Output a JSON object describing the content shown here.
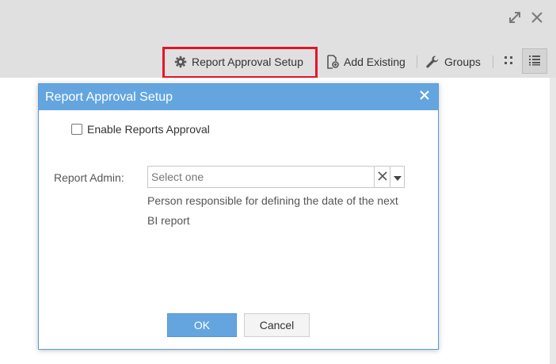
{
  "toolbar": {
    "report_approval_label": "Report Approval Setup",
    "add_existing_label": "Add Existing",
    "groups_label": "Groups"
  },
  "dialog": {
    "title": "Report Approval Setup",
    "enable_label": "Enable Reports Approval",
    "report_admin_label": "Report Admin:",
    "report_admin_placeholder": "Select one",
    "report_admin_help": "Person responsible for defining the date of the next BI report",
    "ok_label": "OK",
    "cancel_label": "Cancel"
  },
  "colors": {
    "accent": "#64a5e0",
    "highlight": "#e0162b"
  },
  "icons": {
    "expand": "expand-icon",
    "close": "close-icon",
    "gear": "gear-icon",
    "add_existing": "add-existing-icon",
    "wrench": "wrench-icon",
    "grid_view": "grid-view-icon",
    "list_view": "list-view-icon"
  }
}
